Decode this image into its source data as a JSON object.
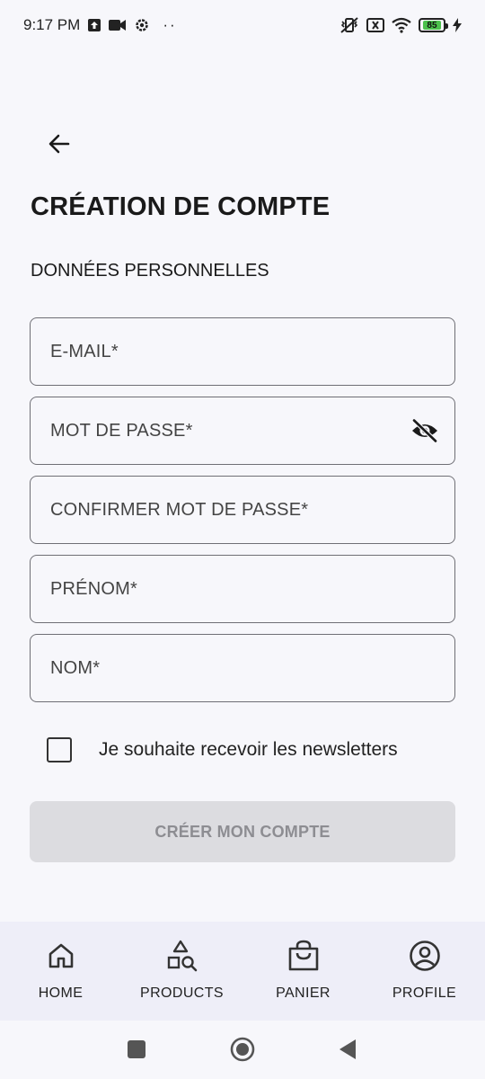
{
  "status_bar": {
    "time": "9:17 PM",
    "dots": "··",
    "battery_level": "85"
  },
  "header": {
    "title": "CRÉATION DE COMPTE",
    "section": "DONNÉES PERSONNELLES"
  },
  "form": {
    "email_placeholder": "E-MAIL*",
    "password_placeholder": "MOT DE PASSE*",
    "confirm_password_placeholder": "CONFIRMER MOT DE PASSE*",
    "first_name_placeholder": "PRÉNOM*",
    "last_name_placeholder": "NOM*",
    "newsletter_label": "Je souhaite recevoir les newsletters",
    "newsletter_checked": false,
    "submit_label": "CRÉER MON COMPTE"
  },
  "bottom_nav": {
    "items": [
      {
        "label": "HOME",
        "icon": "home-icon"
      },
      {
        "label": "PRODUCTS",
        "icon": "shapes-search-icon"
      },
      {
        "label": "PANIER",
        "icon": "shopping-bag-icon"
      },
      {
        "label": "PROFILE",
        "icon": "account-circle-icon"
      }
    ]
  },
  "colors": {
    "background": "#f7f7fb",
    "nav_background": "#eeeef8",
    "button_disabled": "#dcdce0",
    "button_disabled_text": "#8d8d92",
    "battery": "#4cc14c"
  }
}
